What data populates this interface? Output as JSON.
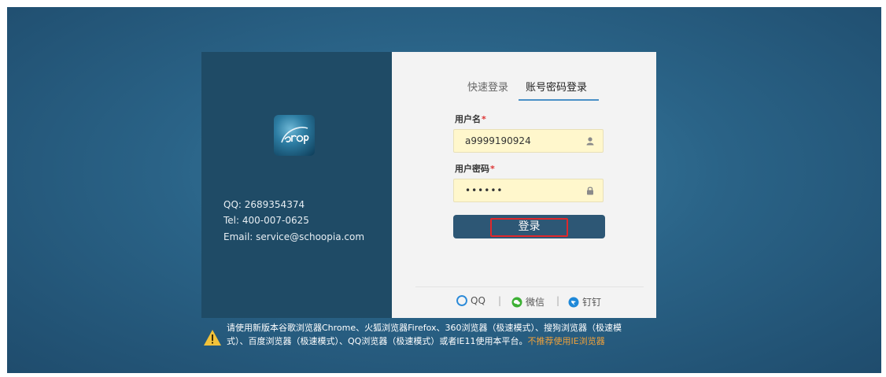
{
  "brand": {
    "logo_icon": "schoopia-logo-icon"
  },
  "contact": {
    "qq": "QQ: 2689354374",
    "tel": "Tel: 400-007-0625",
    "email": "Email: service@schoopia.com"
  },
  "tabs": [
    {
      "label": "快速登录",
      "active": false
    },
    {
      "label": "账号密码登录",
      "active": true
    }
  ],
  "form": {
    "username": {
      "label": "用户名",
      "required_mark": "*",
      "value": "a9999190924",
      "icon": "user-icon"
    },
    "password": {
      "label": "用户密码",
      "required_mark": "*",
      "value": "••••••",
      "icon": "lock-icon"
    },
    "submit_label": "登录"
  },
  "social_login": {
    "items": [
      {
        "label": "QQ",
        "icon": "qq-icon",
        "color": "#2b8ad8"
      },
      {
        "label": "微信",
        "icon": "wechat-icon",
        "color": "#3cb034"
      },
      {
        "label": "钉钉",
        "icon": "dingtalk-icon",
        "color": "#1e88d8"
      }
    ],
    "separator": "|"
  },
  "notice": {
    "icon": "warning-icon",
    "line1": "请使用新版本谷歌浏览器Chrome、火狐浏览器Firefox、360浏览器（极速模式）、搜狗浏览器（极速模",
    "line2": "式）、百度浏览器（极速模式）、QQ浏览器（极速模式）或者IE11使用本平台。",
    "highlight": "不推荐使用IE浏览器"
  },
  "colors": {
    "background": "#2a6387",
    "left_panel": "#1f4b66",
    "right_panel": "#f3f3f3",
    "button": "#2d5775",
    "input_bg": "#fff7cc",
    "required": "#dd3333",
    "notice_highlight": "#f0a13a"
  }
}
